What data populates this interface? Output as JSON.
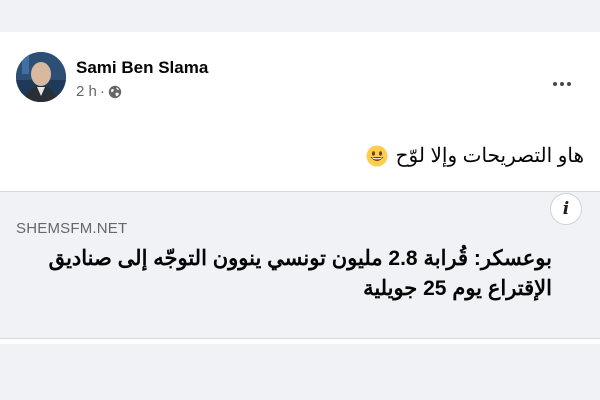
{
  "post": {
    "author_name": "Sami Ben Slama",
    "timestamp": "2 h",
    "separator": "·",
    "privacy_icon": "globe-icon",
    "more_icon": "more-horizontal-icon",
    "text": "هاو التصريحات وإلا لوّح",
    "emoji_icon": "grinning-face-emoji"
  },
  "link_preview": {
    "domain": "SHEMSFM.NET",
    "title": "بوعسكر: قُرابة 2.8 مليون تونسي ينوون التوجّه إلى صناديق الإقتراع يوم 25 جويلية",
    "info_icon": "info-icon",
    "info_label": "i"
  },
  "colors": {
    "page_background": "#f0f2f5",
    "card_background": "#ffffff",
    "primary_text": "#050505",
    "secondary_text": "#65676b",
    "emoji_yellow": "#ffcc4d"
  }
}
